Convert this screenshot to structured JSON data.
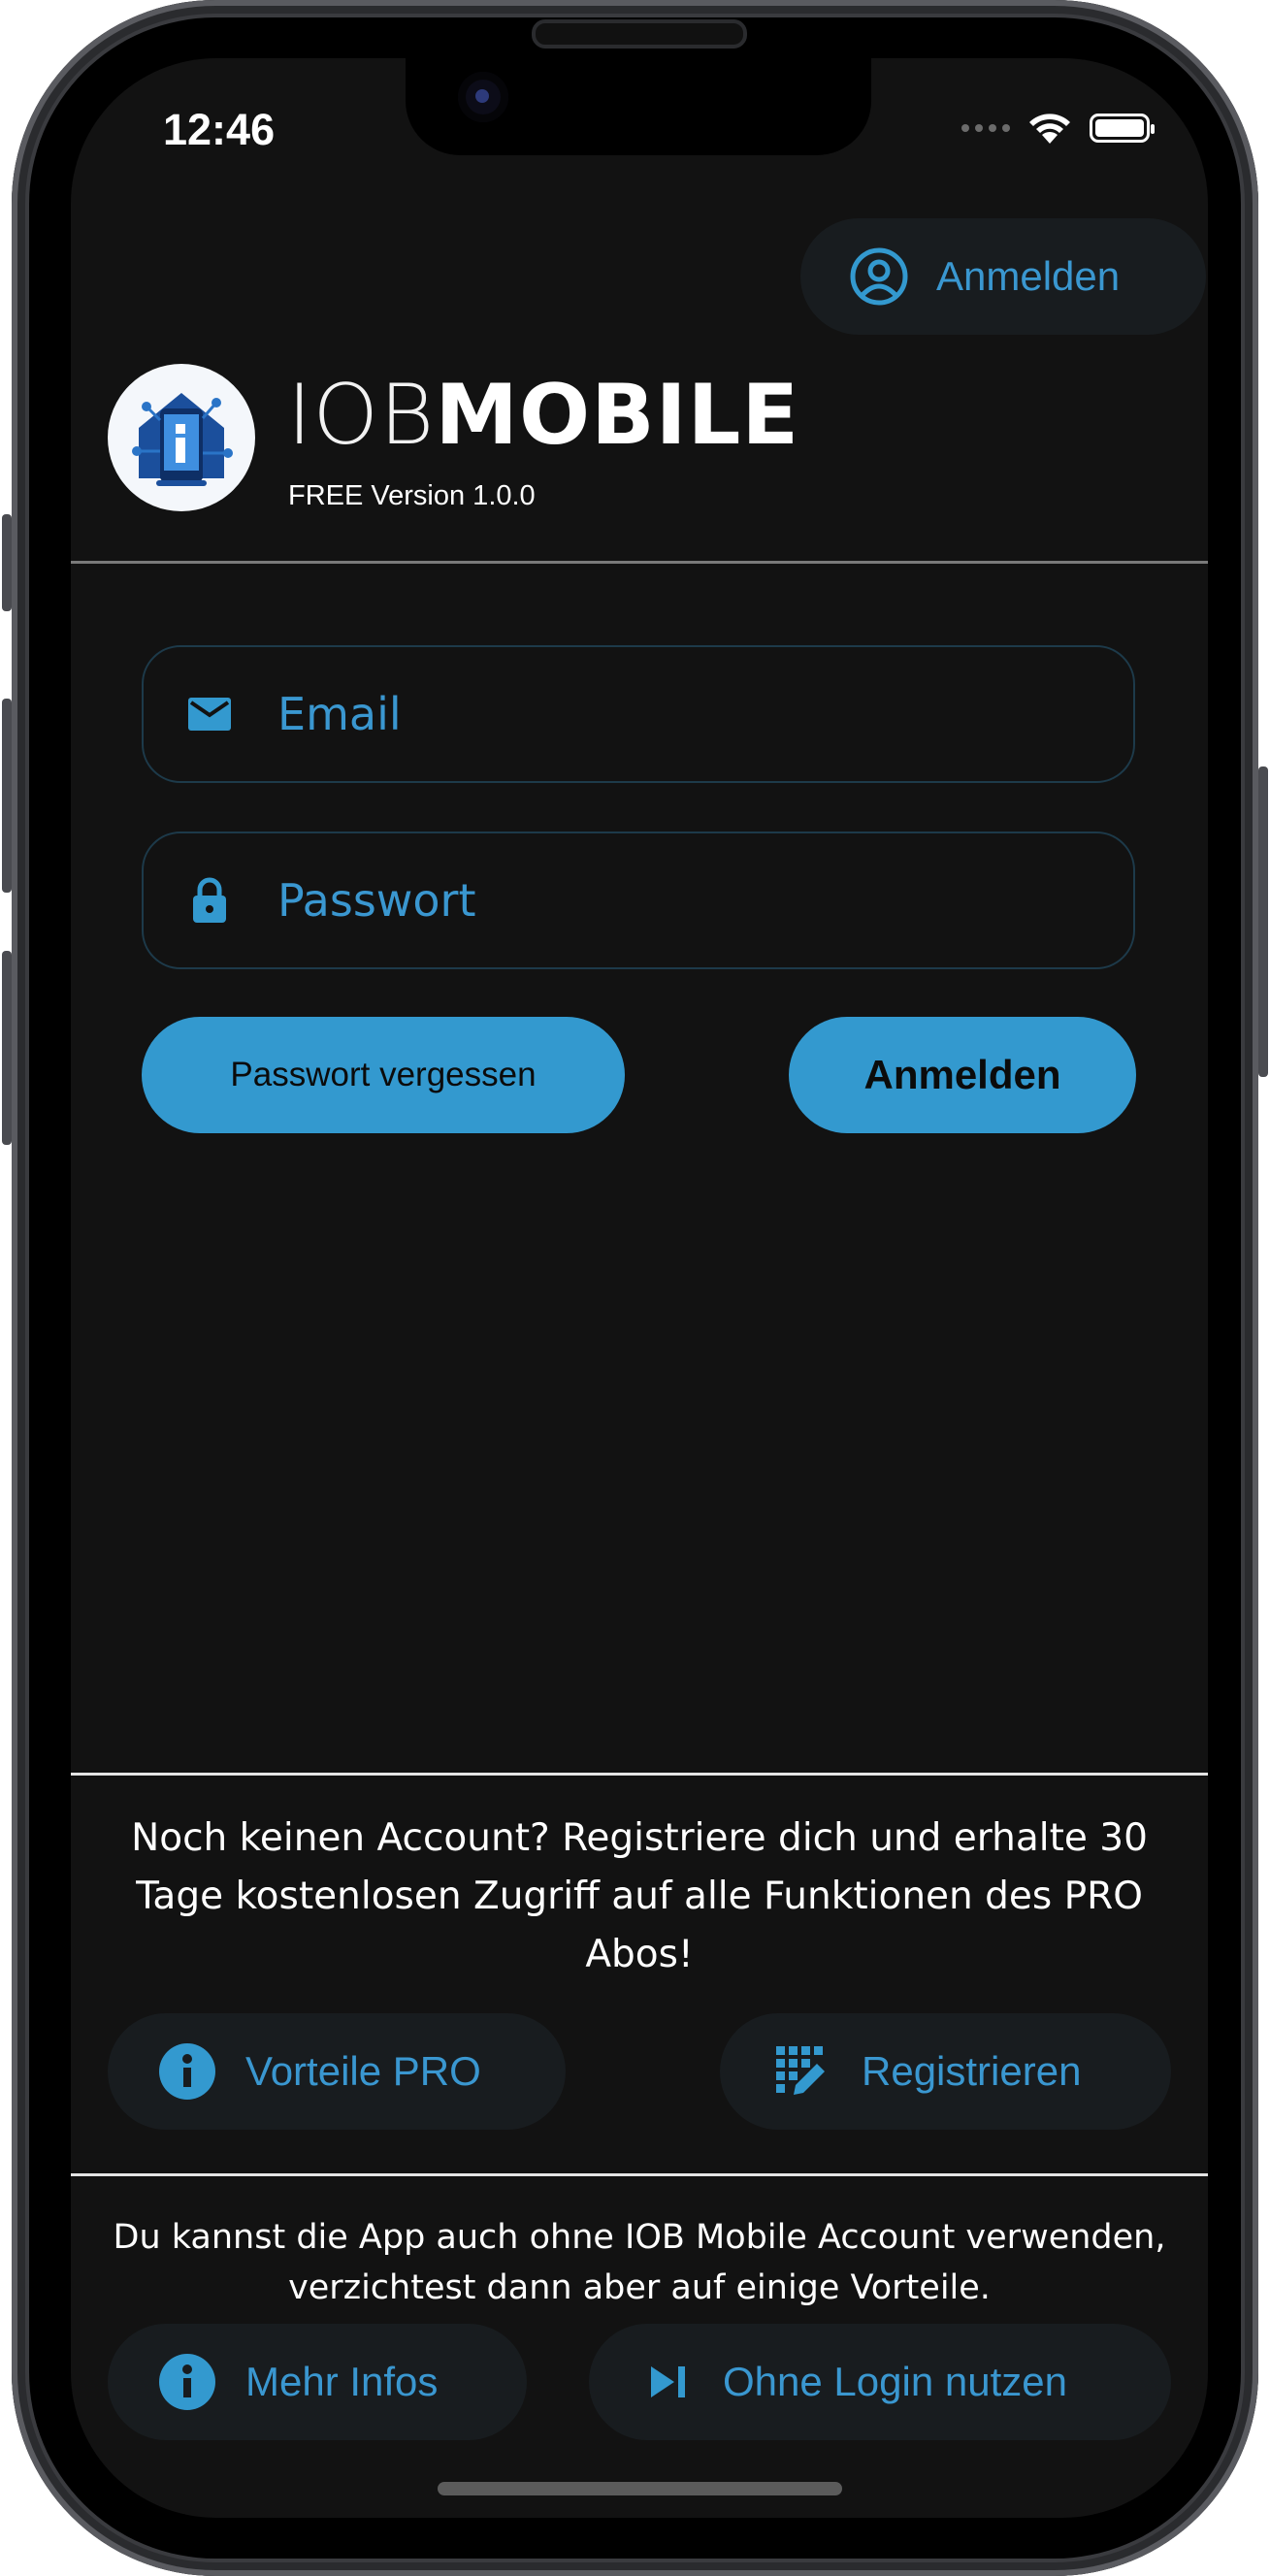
{
  "status_bar": {
    "time": "12:46"
  },
  "header": {
    "login_button_label": "Anmelden",
    "brand_light": "IOB",
    "brand_bold": "MOBILE",
    "version": "FREE Version 1.0.0"
  },
  "login_form": {
    "email_placeholder": "Email",
    "password_placeholder": "Passwort",
    "forgot_password_label": "Passwort vergessen",
    "submit_label": "Anmelden"
  },
  "register_section": {
    "text": "Noch keinen Account? Registriere dich und erhalte 30 Tage kostenlosen Zugriff auf alle Funktionen des PRO Abos!",
    "benefits_button_label": "Vorteile PRO",
    "register_button_label": "Registrieren"
  },
  "guest_section": {
    "text": "Du kannst die App auch ohne IOB Mobile Account verwenden, verzichtest dann aber auf einige Vorteile.",
    "more_info_label": "Mehr Infos",
    "guest_button_label": "Ohne Login nutzen"
  },
  "colors": {
    "accent": "#3399cf",
    "background": "#121212",
    "button_surface": "#181c1f",
    "text": "#ffffff"
  },
  "icons": [
    "account-circle-icon",
    "mail-icon",
    "lock-icon",
    "info-icon",
    "registration-icon",
    "skip-next-icon",
    "wifi-icon",
    "battery-icon",
    "signal-icon"
  ]
}
